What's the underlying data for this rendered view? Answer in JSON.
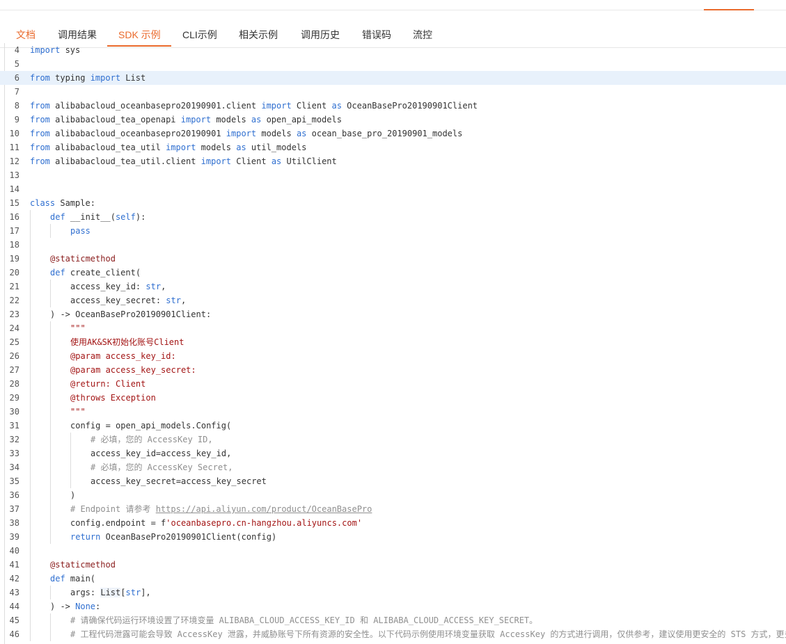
{
  "tabs": [
    {
      "label": "文档"
    },
    {
      "label": "调用结果"
    },
    {
      "label": "SDK 示例"
    },
    {
      "label": "CLI示例"
    },
    {
      "label": "相关示例"
    },
    {
      "label": "调用历史"
    },
    {
      "label": "错误码"
    },
    {
      "label": "流控"
    }
  ],
  "active_tab_index": 2,
  "highlighted_line": 6,
  "colors": {
    "accent": "#ea6a2c",
    "keyword": "#2f6fd0",
    "string": "#a31515",
    "comment": "#8f8f8f",
    "highlight_bg": "#e8f1fb"
  },
  "code": [
    {
      "num": "4",
      "indent": 0,
      "tokens": [
        {
          "t": "import",
          "s": "k"
        },
        {
          "t": " sys",
          "s": "n"
        }
      ]
    },
    {
      "num": "5",
      "indent": 0,
      "tokens": []
    },
    {
      "num": "6",
      "indent": 0,
      "tokens": [
        {
          "t": "from",
          "s": "k"
        },
        {
          "t": " typing ",
          "s": "n"
        },
        {
          "t": "import",
          "s": "k"
        },
        {
          "t": " List",
          "s": "n"
        }
      ]
    },
    {
      "num": "7",
      "indent": 0,
      "tokens": []
    },
    {
      "num": "8",
      "indent": 0,
      "tokens": [
        {
          "t": "from",
          "s": "k"
        },
        {
          "t": " alibabacloud_oceanbasepro20190901.client ",
          "s": "n"
        },
        {
          "t": "import",
          "s": "k"
        },
        {
          "t": " Client ",
          "s": "n"
        },
        {
          "t": "as",
          "s": "k"
        },
        {
          "t": " OceanBasePro20190901Client",
          "s": "n"
        }
      ]
    },
    {
      "num": "9",
      "indent": 0,
      "tokens": [
        {
          "t": "from",
          "s": "k"
        },
        {
          "t": " alibabacloud_tea_openapi ",
          "s": "n"
        },
        {
          "t": "import",
          "s": "k"
        },
        {
          "t": " models ",
          "s": "n"
        },
        {
          "t": "as",
          "s": "k"
        },
        {
          "t": " open_api_models",
          "s": "n"
        }
      ]
    },
    {
      "num": "10",
      "indent": 0,
      "tokens": [
        {
          "t": "from",
          "s": "k"
        },
        {
          "t": " alibabacloud_oceanbasepro20190901 ",
          "s": "n"
        },
        {
          "t": "import",
          "s": "k"
        },
        {
          "t": " models ",
          "s": "n"
        },
        {
          "t": "as",
          "s": "k"
        },
        {
          "t": " ocean_base_pro_20190901_models",
          "s": "n"
        }
      ]
    },
    {
      "num": "11",
      "indent": 0,
      "tokens": [
        {
          "t": "from",
          "s": "k"
        },
        {
          "t": " alibabacloud_tea_util ",
          "s": "n"
        },
        {
          "t": "import",
          "s": "k"
        },
        {
          "t": " models ",
          "s": "n"
        },
        {
          "t": "as",
          "s": "k"
        },
        {
          "t": " util_models",
          "s": "n"
        }
      ]
    },
    {
      "num": "12",
      "indent": 0,
      "tokens": [
        {
          "t": "from",
          "s": "k"
        },
        {
          "t": " alibabacloud_tea_util.client ",
          "s": "n"
        },
        {
          "t": "import",
          "s": "k"
        },
        {
          "t": " Client ",
          "s": "n"
        },
        {
          "t": "as",
          "s": "k"
        },
        {
          "t": " UtilClient",
          "s": "n"
        }
      ]
    },
    {
      "num": "13",
      "indent": 0,
      "tokens": []
    },
    {
      "num": "14",
      "indent": 0,
      "tokens": []
    },
    {
      "num": "15",
      "indent": 0,
      "tokens": [
        {
          "t": "class",
          "s": "k"
        },
        {
          "t": " Sample:",
          "s": "n"
        }
      ]
    },
    {
      "num": "16",
      "indent": 1,
      "tokens": [
        {
          "t": "def",
          "s": "k"
        },
        {
          "t": " __init__(",
          "s": "n"
        },
        {
          "t": "self",
          "s": "k"
        },
        {
          "t": "):",
          "s": "n"
        }
      ]
    },
    {
      "num": "17",
      "indent": 2,
      "tokens": [
        {
          "t": "pass",
          "s": "k"
        }
      ]
    },
    {
      "num": "18",
      "indent": 1,
      "tokens": []
    },
    {
      "num": "19",
      "indent": 1,
      "tokens": [
        {
          "t": "@staticmethod",
          "s": "d"
        }
      ]
    },
    {
      "num": "20",
      "indent": 1,
      "tokens": [
        {
          "t": "def",
          "s": "k"
        },
        {
          "t": " create_client(",
          "s": "n"
        }
      ]
    },
    {
      "num": "21",
      "indent": 2,
      "tokens": [
        {
          "t": "access_key_id: ",
          "s": "n"
        },
        {
          "t": "str",
          "s": "k"
        },
        {
          "t": ",",
          "s": "n"
        }
      ]
    },
    {
      "num": "22",
      "indent": 2,
      "tokens": [
        {
          "t": "access_key_secret: ",
          "s": "n"
        },
        {
          "t": "str",
          "s": "k"
        },
        {
          "t": ",",
          "s": "n"
        }
      ]
    },
    {
      "num": "23",
      "indent": 1,
      "tokens": [
        {
          "t": ") -> OceanBasePro20190901Client:",
          "s": "n"
        }
      ]
    },
    {
      "num": "24",
      "indent": 2,
      "tokens": [
        {
          "t": "\"\"\"",
          "s": "r"
        }
      ]
    },
    {
      "num": "25",
      "indent": 2,
      "tokens": [
        {
          "t": "使用AK&SK初始化账号Client",
          "s": "r"
        }
      ]
    },
    {
      "num": "26",
      "indent": 2,
      "tokens": [
        {
          "t": "@param access_key_id:",
          "s": "r"
        }
      ]
    },
    {
      "num": "27",
      "indent": 2,
      "tokens": [
        {
          "t": "@param access_key_secret:",
          "s": "r"
        }
      ]
    },
    {
      "num": "28",
      "indent": 2,
      "tokens": [
        {
          "t": "@return: Client",
          "s": "r"
        }
      ]
    },
    {
      "num": "29",
      "indent": 2,
      "tokens": [
        {
          "t": "@throws Exception",
          "s": "r"
        }
      ]
    },
    {
      "num": "30",
      "indent": 2,
      "tokens": [
        {
          "t": "\"\"\"",
          "s": "r"
        }
      ]
    },
    {
      "num": "31",
      "indent": 2,
      "tokens": [
        {
          "t": "config = open_api_models.Config(",
          "s": "n"
        }
      ]
    },
    {
      "num": "32",
      "indent": 3,
      "tokens": [
        {
          "t": "# 必填，您的 AccessKey ID,",
          "s": "c"
        }
      ]
    },
    {
      "num": "33",
      "indent": 3,
      "tokens": [
        {
          "t": "access_key_id=access_key_id,",
          "s": "n"
        }
      ]
    },
    {
      "num": "34",
      "indent": 3,
      "tokens": [
        {
          "t": "# 必填，您的 AccessKey Secret,",
          "s": "c"
        }
      ]
    },
    {
      "num": "35",
      "indent": 3,
      "tokens": [
        {
          "t": "access_key_secret=access_key_secret",
          "s": "n"
        }
      ]
    },
    {
      "num": "36",
      "indent": 2,
      "tokens": [
        {
          "t": ")",
          "s": "n"
        }
      ]
    },
    {
      "num": "37",
      "indent": 2,
      "tokens": [
        {
          "t": "# Endpoint 请参考 ",
          "s": "c"
        },
        {
          "t": "https://api.aliyun.com/product/OceanBasePro",
          "s": "u"
        }
      ]
    },
    {
      "num": "38",
      "indent": 2,
      "tokens": [
        {
          "t": "config.endpoint = f",
          "s": "n"
        },
        {
          "t": "'oceanbasepro.cn-hangzhou.aliyuncs.com'",
          "s": "r"
        }
      ]
    },
    {
      "num": "39",
      "indent": 2,
      "tokens": [
        {
          "t": "return",
          "s": "k"
        },
        {
          "t": " OceanBasePro20190901Client(config)",
          "s": "n"
        }
      ]
    },
    {
      "num": "40",
      "indent": 1,
      "tokens": []
    },
    {
      "num": "41",
      "indent": 1,
      "tokens": [
        {
          "t": "@staticmethod",
          "s": "d"
        }
      ]
    },
    {
      "num": "42",
      "indent": 1,
      "tokens": [
        {
          "t": "def",
          "s": "k"
        },
        {
          "t": " main(",
          "s": "n"
        }
      ]
    },
    {
      "num": "43",
      "indent": 2,
      "tokens": [
        {
          "t": "args: ",
          "s": "n"
        },
        {
          "t": "List",
          "s": "box"
        },
        {
          "t": "[",
          "s": "n"
        },
        {
          "t": "str",
          "s": "k"
        },
        {
          "t": "],",
          "s": "n"
        }
      ]
    },
    {
      "num": "44",
      "indent": 1,
      "tokens": [
        {
          "t": ") -> ",
          "s": "n"
        },
        {
          "t": "None",
          "s": "k"
        },
        {
          "t": ":",
          "s": "n"
        }
      ]
    },
    {
      "num": "45",
      "indent": 2,
      "tokens": [
        {
          "t": "# 请确保代码运行环境设置了环境变量 ALIBABA_CLOUD_ACCESS_KEY_ID 和 ALIBABA_CLOUD_ACCESS_KEY_SECRET。",
          "s": "c"
        }
      ]
    },
    {
      "num": "46",
      "indent": 2,
      "tokens": [
        {
          "t": "# 工程代码泄露可能会导致 AccessKey 泄露，并威胁账号下所有资源的安全性。以下代码示例使用环境变量获取 AccessKey 的方式进行调用，仅供参考，建议使用更安全的 STS 方式，更多",
          "s": "c"
        }
      ]
    }
  ]
}
